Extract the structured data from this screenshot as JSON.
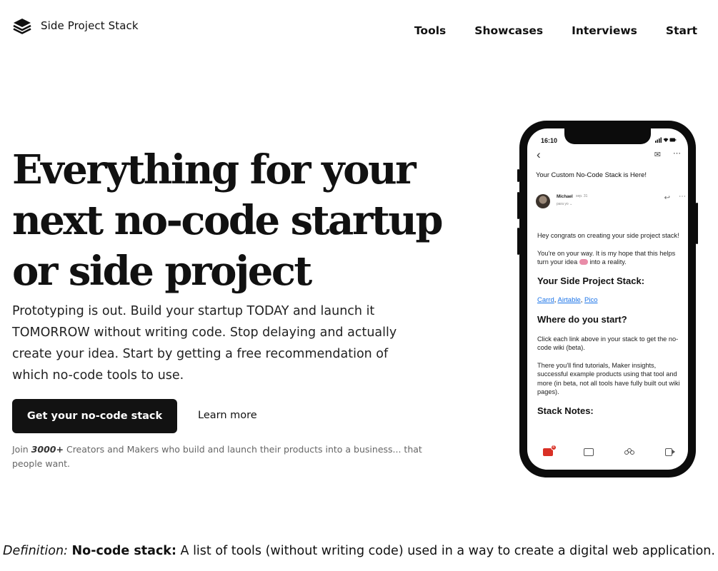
{
  "brand": {
    "name": "Side Project Stack",
    "logo_icon": "layers-icon"
  },
  "nav": {
    "items": [
      "Tools",
      "Showcases",
      "Interviews",
      "Start"
    ]
  },
  "hero": {
    "headline": "Everything for your next no-code startup or side project",
    "lead": "Prototyping is out. Build your startup TODAY and launch it TOMORROW without writing code. Stop delaying and actually create your idea. Start by getting a free recommendation of which no-code tools to use.",
    "cta_label": "Get your no-code stack",
    "learn_more_label": "Learn more",
    "join_prefix": "Join",
    "join_count": "3000+",
    "join_suffix": "Creators and Makers who build and launch their products into a business... that people want."
  },
  "phone": {
    "time": "16:10",
    "status_icons": "signal-wifi-battery",
    "subject": "Your Custom No-Code Stack is Here!",
    "sender_name": "Michael",
    "sender_date": "sep. 31",
    "sender_to": "para yo ⌄",
    "body": {
      "p1": "Hey congrats on creating your side project stack!",
      "p2_before": "You're on your way. It is my hope that this helps turn your idea",
      "p2_after": "into a reality.",
      "h1": "Your Side Project Stack:",
      "links": [
        "Carrd",
        "Airtable",
        "Pico"
      ],
      "h2": "Where do you start?",
      "p3": "Click each link above in your stack to get the no-code wiki (beta).",
      "p4": "There you'll find tutorials, Maker insights, successful example products using that tool and more (in beta, not all tools have fully built out wiki pages).",
      "h3": "Stack Notes:"
    },
    "mail_badge": "4"
  },
  "definition": {
    "prefix": "Definition:",
    "term": "No-code stack:",
    "text": "A list of tools (without writing code) used in a way to create a digital web application."
  },
  "colors": {
    "cta_bg": "#121212",
    "link": "#1a73e8",
    "phone_frame": "#0c0c0c"
  }
}
